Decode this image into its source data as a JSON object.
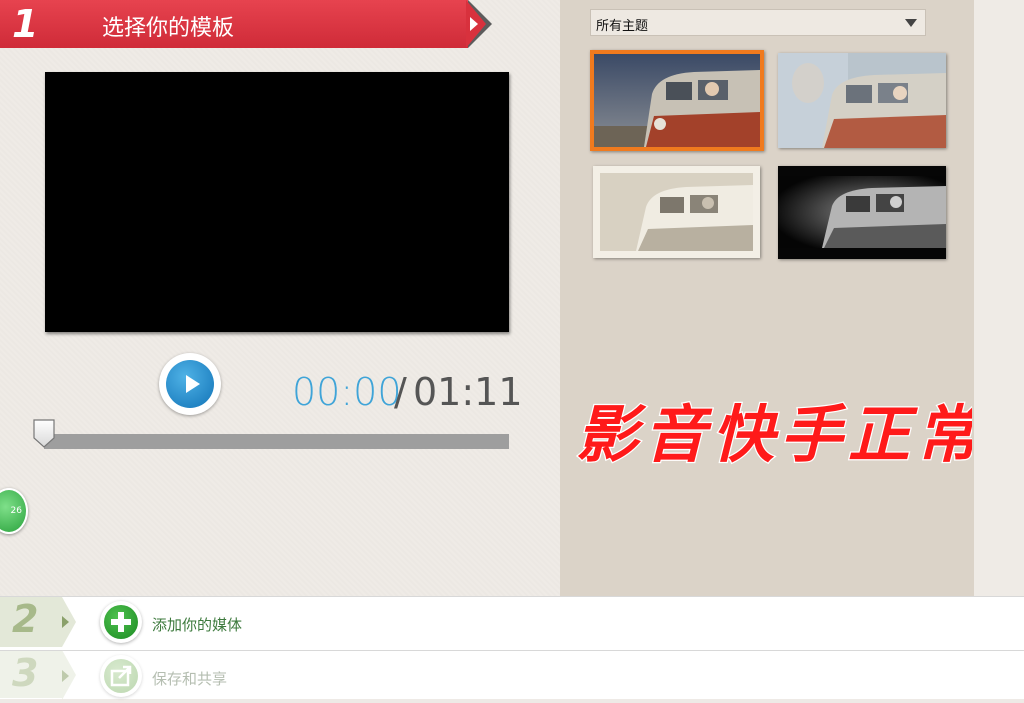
{
  "step1": {
    "number": "1",
    "title": "选择你的模板"
  },
  "player": {
    "current_time": "00:00",
    "separator": "/",
    "total_time": "01:11",
    "progress": 0
  },
  "badge": {
    "text": "26"
  },
  "themes": {
    "selected_filter": "所有主题",
    "items": [
      {
        "id": "theme-1",
        "style": "color",
        "selected": true
      },
      {
        "id": "theme-2",
        "style": "faded-overlay",
        "selected": false
      },
      {
        "id": "theme-3",
        "style": "sepia-border",
        "selected": false
      },
      {
        "id": "theme-4",
        "style": "dark-vignette",
        "selected": false
      }
    ]
  },
  "watermark": {
    "text": "影音快手正常"
  },
  "step2": {
    "number": "2",
    "label": "添加你的媒体"
  },
  "step3": {
    "number": "3",
    "label": "保存和共享"
  },
  "colors": {
    "accent_red": "#d8313d",
    "accent_blue": "#3fa4d8",
    "selected_orange": "#f07a1e",
    "step_green": "#2a9d2f"
  }
}
